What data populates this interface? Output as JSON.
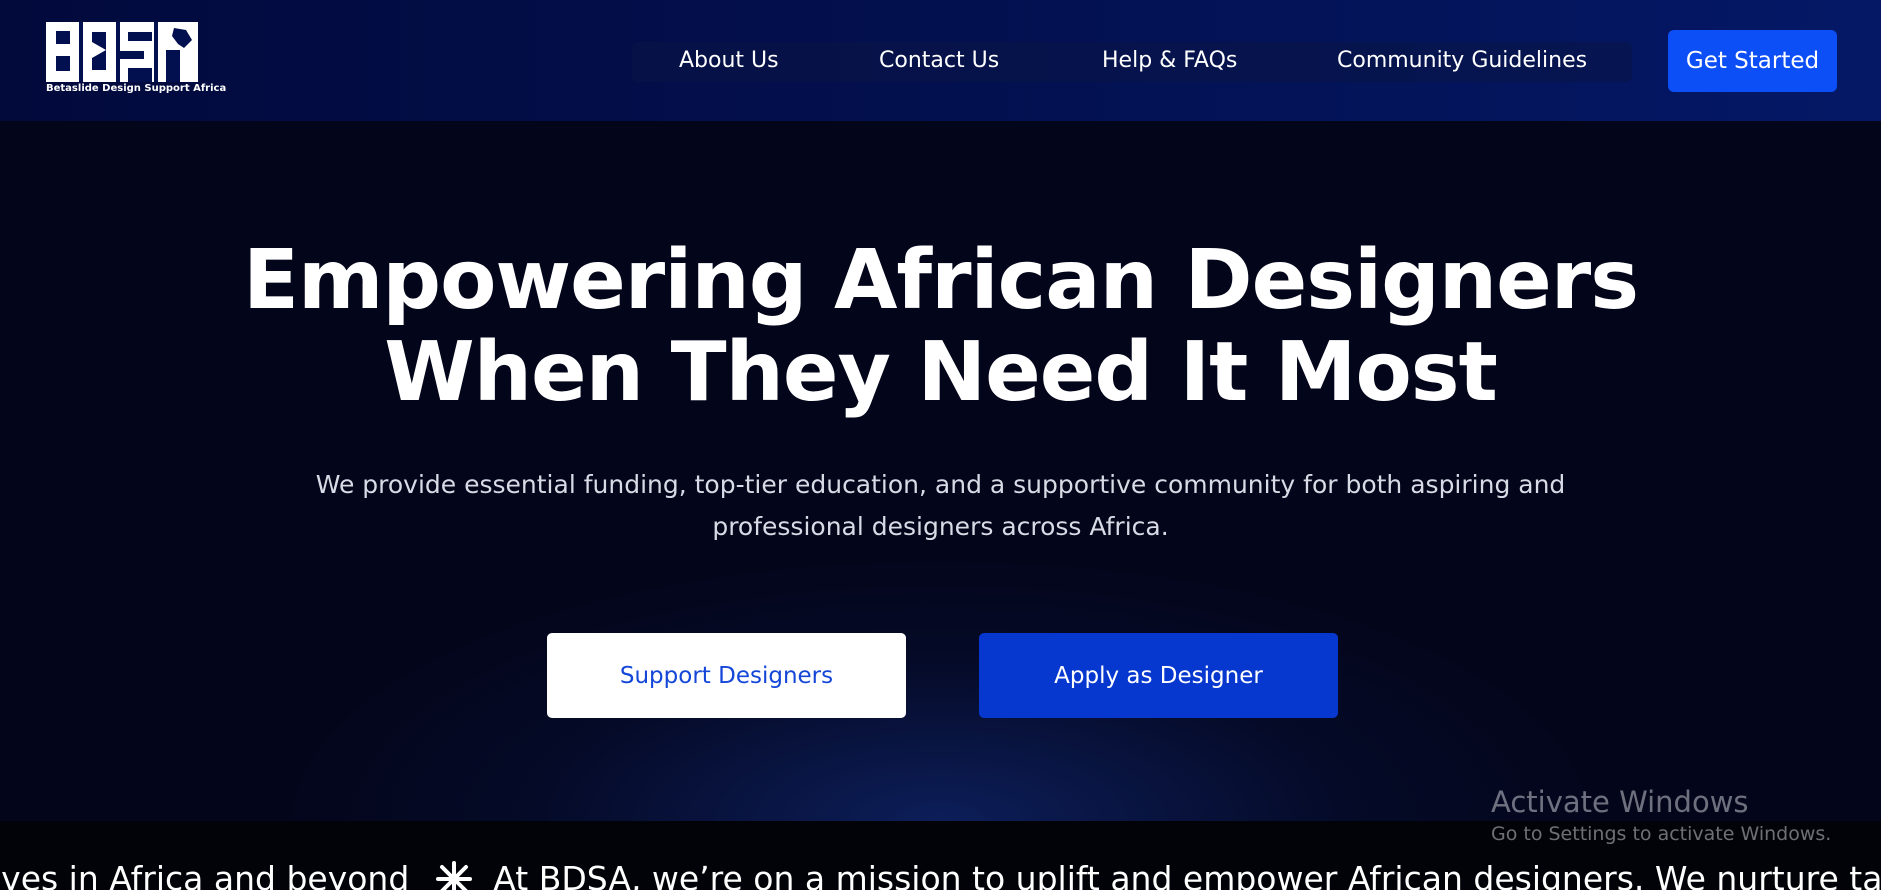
{
  "brand": {
    "logo_text": "BDSA",
    "tagline": "Betaslide Design Support Africa"
  },
  "nav": {
    "items": [
      {
        "label": "About Us"
      },
      {
        "label": "Contact Us"
      },
      {
        "label": "Help & FAQs"
      },
      {
        "label": "Community Guidelines"
      }
    ],
    "cta_label": "Get Started"
  },
  "hero": {
    "title_line1": "Empowering African Designers",
    "title_line2": "When They Need It Most",
    "subtitle_line1": "We provide essential funding, top-tier education, and a supportive community for both aspiring and",
    "subtitle_line2": "professional designers across Africa.",
    "primary_button": "Support Designers",
    "secondary_button": "Apply as Designer"
  },
  "ticker": {
    "text_before": "ives in Africa and beyond",
    "separator_icon": "asterisk-star-icon",
    "text_after": "At BDSA, we’re on a mission to uplift and empower African designers. We nurture ta"
  },
  "watermark": {
    "title": "Activate Windows",
    "subtitle": "Go to Settings to activate Windows."
  },
  "colors": {
    "accent_blue": "#0d4ff7",
    "apply_button": "#0638cf",
    "header_dark": "#020a3c",
    "hero_bg": "#03051a"
  }
}
